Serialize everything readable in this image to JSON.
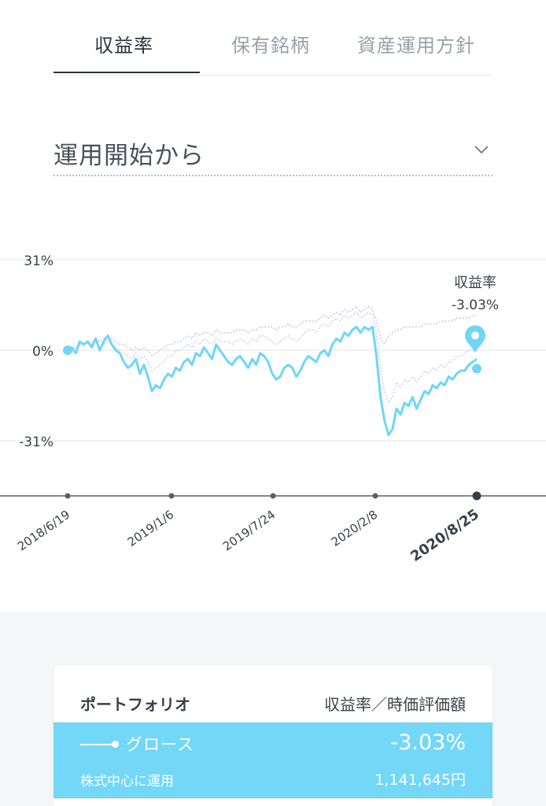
{
  "tabs": [
    {
      "label": "収益率",
      "active": true
    },
    {
      "label": "保有銘柄",
      "active": false
    },
    {
      "label": "資産運用方針",
      "active": false
    }
  ],
  "period_selector": {
    "label": "運用開始から",
    "icon": "chevron-down-icon"
  },
  "chart_data": {
    "type": "line",
    "y_ticks": [
      "31%",
      "0%",
      "-31%"
    ],
    "ylim": [
      -31,
      31
    ],
    "x_ticks": [
      "2018/6/19",
      "2019/1/6",
      "2019/7/24",
      "2020/2/8",
      "2020/8/25"
    ],
    "selected_x": "2020/8/25",
    "tooltip": {
      "label": "収益率",
      "value": "-3.03%"
    },
    "series": [
      {
        "color": "#6fd6f6",
        "values": [
          0,
          1,
          -1,
          3,
          2,
          3,
          1,
          4,
          0,
          3,
          5,
          2,
          0,
          -1,
          -4,
          -6,
          -5,
          -3,
          -8,
          -5,
          -9,
          -14,
          -12,
          -13,
          -10,
          -8,
          -9,
          -6,
          -7,
          -4,
          -3,
          -5,
          -1,
          -2,
          1,
          -1,
          -3,
          2,
          0,
          -2,
          -4,
          -5,
          -3,
          -2,
          -4,
          -6,
          -3,
          -5,
          -1,
          -2,
          -4,
          -8,
          -10,
          -9,
          -6,
          -5,
          -6,
          -9,
          -7,
          -4,
          -2,
          -3,
          -4,
          -1,
          0,
          -2,
          2,
          4,
          3,
          6,
          5,
          7,
          8,
          6,
          8,
          7,
          8,
          -2,
          -16,
          -24,
          -29,
          -27,
          -20,
          -22,
          -18,
          -19,
          -16,
          -20,
          -17,
          -14,
          -15,
          -12,
          -13,
          -11,
          -12,
          -9,
          -10,
          -8,
          -7,
          -7,
          -5,
          -4,
          -3.03
        ]
      },
      {
        "color": "#c9ccf2",
        "values": [
          0,
          0.5,
          1,
          1.5,
          2,
          2.5,
          2,
          3,
          1.5,
          2,
          3,
          2,
          1,
          0,
          -1,
          -2,
          -3,
          -1,
          -3,
          -2,
          -4,
          -7,
          -6,
          -5,
          -4,
          -2,
          -2,
          0,
          0,
          1,
          2,
          1,
          3,
          2,
          4,
          3,
          2,
          4,
          3,
          3,
          3,
          2,
          3,
          4,
          3,
          2,
          4,
          3,
          5,
          5,
          4,
          3,
          2,
          3,
          4,
          5,
          4,
          3,
          4,
          6,
          7,
          7,
          6,
          8,
          9,
          8,
          10,
          11,
          10,
          12,
          11,
          12,
          13,
          11,
          12,
          13,
          12,
          6,
          -6,
          -14,
          -18,
          -16,
          -11,
          -13,
          -10,
          -11,
          -9,
          -11,
          -9,
          -7,
          -8,
          -6,
          -7,
          -5,
          -6,
          -4,
          -4,
          -2,
          -2,
          -1,
          0,
          0,
          1
        ]
      },
      {
        "color": "#c3c6d8",
        "values": [
          0,
          0.5,
          1,
          2,
          2,
          3,
          3,
          4,
          3,
          4,
          5,
          4,
          3,
          2,
          2,
          1,
          0,
          1,
          0,
          1,
          0,
          -2,
          -1,
          0,
          1,
          2,
          2,
          3,
          3,
          4,
          5,
          4,
          6,
          5,
          6,
          6,
          5,
          7,
          6,
          6,
          6,
          6,
          7,
          7,
          7,
          6,
          7,
          7,
          8,
          8,
          8,
          8,
          7,
          8,
          8,
          9,
          8,
          8,
          9,
          10,
          10,
          10,
          10,
          11,
          12,
          11,
          12,
          13,
          12,
          14,
          13,
          14,
          15,
          13,
          14,
          15,
          14,
          10,
          4,
          2,
          5,
          6,
          7,
          7,
          8,
          8,
          8,
          8,
          8,
          9,
          9,
          9,
          9,
          10,
          10,
          10,
          10,
          11,
          11,
          11,
          11,
          12,
          12
        ]
      }
    ]
  },
  "portfolio": {
    "header_left": "ポートフォリオ",
    "header_right": "収益率／時価評価額",
    "rows": [
      {
        "name": "グロース",
        "description": "株式中心に運用",
        "rate": "-3.03%",
        "value": "1,141,645",
        "unit": "円",
        "color": "#73d7f7"
      }
    ]
  }
}
